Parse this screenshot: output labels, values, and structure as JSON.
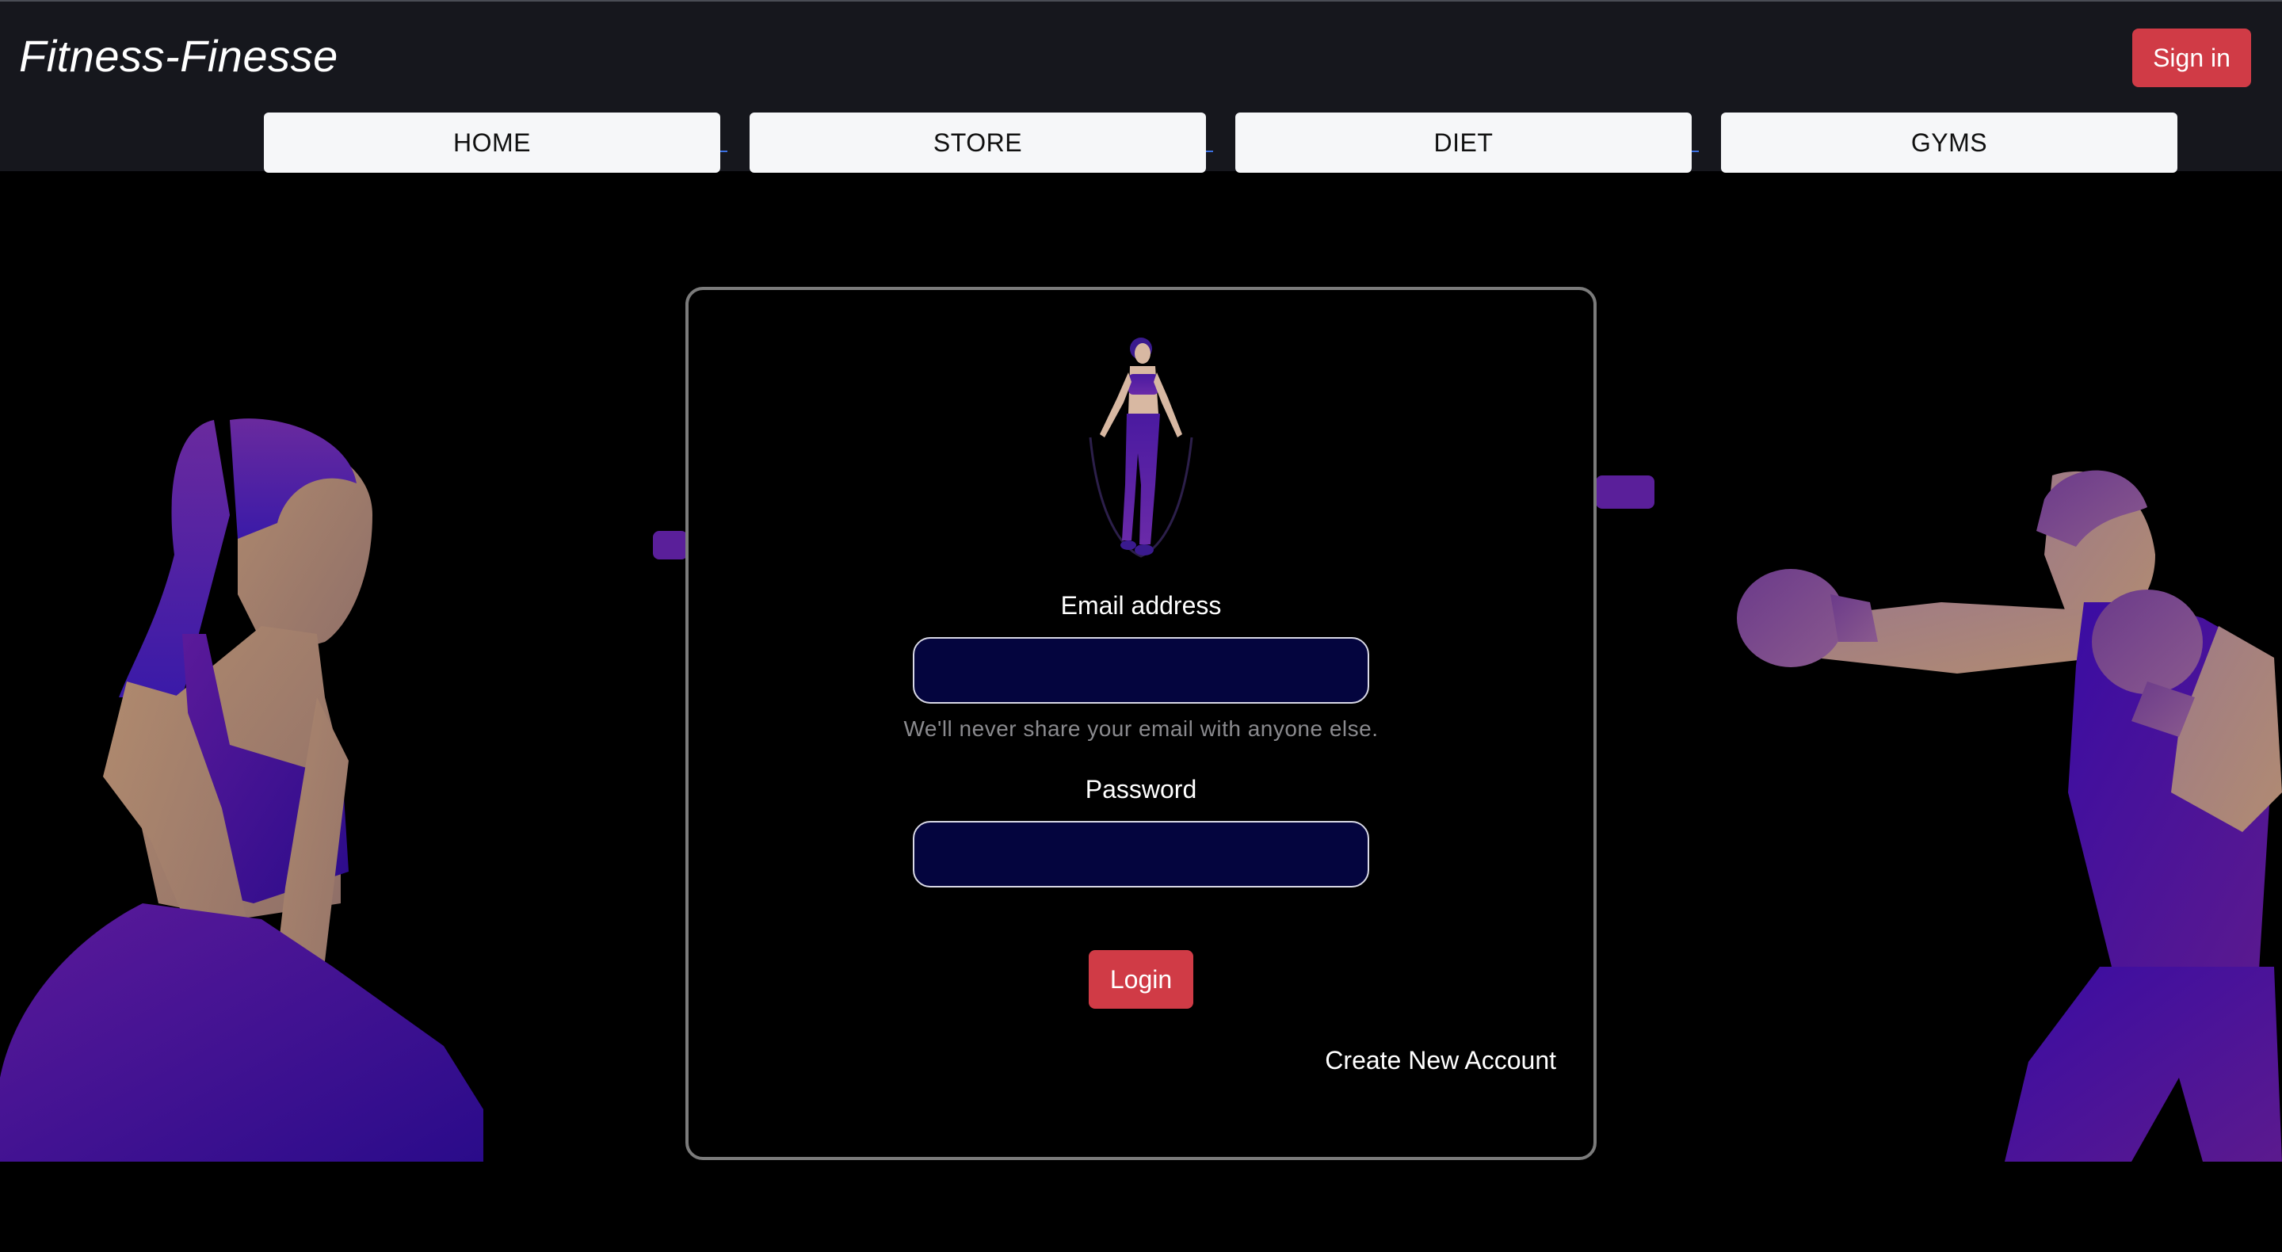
{
  "header": {
    "brand": "Fitness-Finesse",
    "signin_label": "Sign in"
  },
  "nav": {
    "tabs": [
      {
        "label": "HOME"
      },
      {
        "label": "STORE"
      },
      {
        "label": "DIET"
      },
      {
        "label": "GYMS"
      }
    ]
  },
  "login": {
    "email_label": "Email address",
    "email_value": "",
    "email_help": "We'll never share your email with anyone else.",
    "password_label": "Password",
    "password_value": "",
    "login_label": "Login",
    "create_account_label": "Create New Account"
  },
  "illustrations": {
    "left": "woman-kneeling-illustration",
    "center": "jump-rope-woman-illustration",
    "right": "boxer-man-illustration"
  },
  "colors": {
    "navbar_bg": "#16171d",
    "page_bg": "#000000",
    "accent_red": "#d03b46",
    "input_bg": "#04053e",
    "illustration_purple": "#3a0ca3",
    "nav_tab_bg": "#f6f7f9"
  }
}
